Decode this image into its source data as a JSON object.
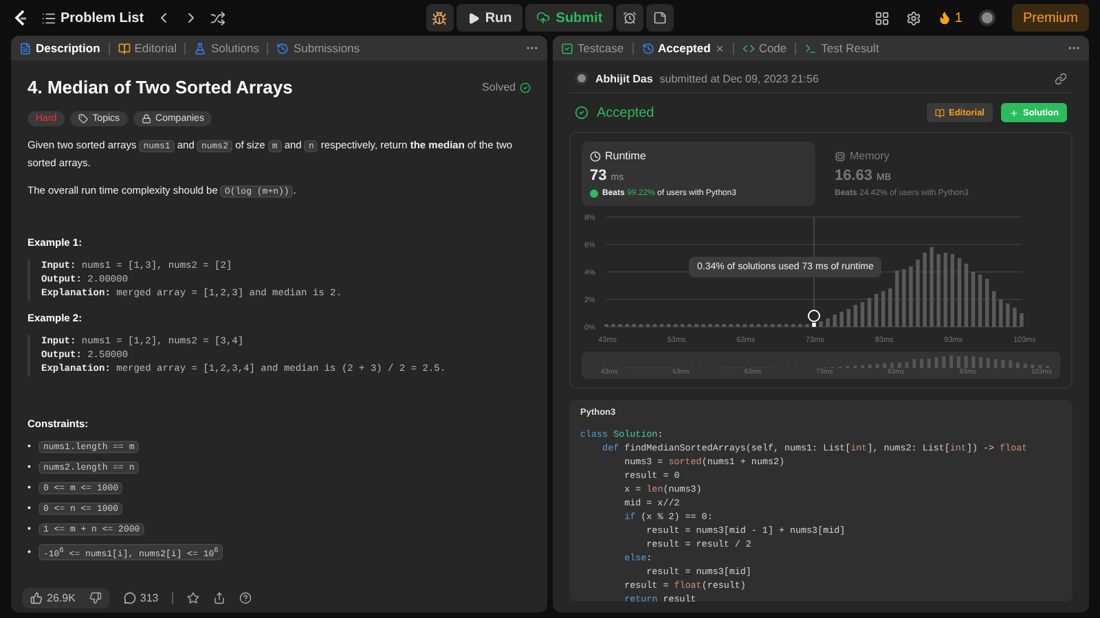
{
  "topbar": {
    "problem_list": "Problem List",
    "run": "Run",
    "submit": "Submit",
    "streak": "1",
    "premium": "Premium"
  },
  "left_panel": {
    "tabs": [
      {
        "label": "Description",
        "selected": true
      },
      {
        "label": "Editorial",
        "selected": false
      },
      {
        "label": "Solutions",
        "selected": false
      },
      {
        "label": "Submissions",
        "selected": false
      }
    ],
    "title": "4. Median of Two Sorted Arrays",
    "status": "Solved",
    "tags": [
      {
        "label": "Hard",
        "kind": "difficulty"
      },
      {
        "label": "Topics",
        "kind": "topics"
      },
      {
        "label": "Companies",
        "kind": "companies"
      }
    ],
    "paragraphs": [
      [
        {
          "text": "Given two sorted arrays ",
          "kind": "text"
        },
        {
          "text": "nums1",
          "kind": "code"
        },
        {
          "text": " and ",
          "kind": "text"
        },
        {
          "text": "nums2",
          "kind": "code"
        },
        {
          "text": " of size ",
          "kind": "text"
        },
        {
          "text": "m",
          "kind": "code"
        },
        {
          "text": " and ",
          "kind": "text"
        },
        {
          "text": "n",
          "kind": "code"
        },
        {
          "text": " respectively, return ",
          "kind": "text"
        },
        {
          "text": "the median",
          "kind": "bold"
        },
        {
          "text": " of the two sorted arrays.",
          "kind": "text"
        }
      ],
      [
        {
          "text": "The overall run time complexity should be ",
          "kind": "text"
        },
        {
          "text": "O(log (m+n))",
          "kind": "code"
        },
        {
          "text": ".",
          "kind": "text"
        }
      ]
    ],
    "examples": [
      {
        "title": "Example 1:",
        "lines": [
          {
            "label": "Input:",
            "value": "nums1 = [1,3], nums2 = [2]"
          },
          {
            "label": "Output:",
            "value": "2.00000"
          },
          {
            "label": "Explanation:",
            "value": "merged array = [1,2,3] and median is 2."
          }
        ]
      },
      {
        "title": "Example 2:",
        "lines": [
          {
            "label": "Input:",
            "value": "nums1 = [1,2], nums2 = [3,4]"
          },
          {
            "label": "Output:",
            "value": "2.50000"
          },
          {
            "label": "Explanation:",
            "value": "merged array = [1,2,3,4] and median is (2 + 3) / 2 = 2.5."
          }
        ]
      }
    ],
    "constraints_title": "Constraints:",
    "constraints": [
      {
        "marker": "•",
        "text": "nums1.length == m"
      },
      {
        "marker": "•",
        "text": "nums2.length == n"
      },
      {
        "marker": "•",
        "text": "0 <= m <= 1000"
      },
      {
        "marker": "•",
        "text": "0 <= n <= 1000"
      },
      {
        "marker": "•",
        "text": "1 <= m + n <= 2000"
      },
      {
        "marker": "•",
        "text": "-10$^{6}$ <= nums1[i], nums2[i] <= 10$^{6}$"
      }
    ],
    "footer": {
      "likes": "26.9K",
      "comments": "313"
    }
  },
  "right_panel": {
    "tabs": [
      {
        "label": "Testcase",
        "closable": false,
        "selected": false
      },
      {
        "label": "Accepted",
        "closable": true,
        "selected": true
      },
      {
        "label": "Code",
        "closable": false,
        "selected": false
      },
      {
        "label": "Test Result",
        "closable": false,
        "selected": false
      }
    ],
    "submitter": {
      "name": "Abhijit Das",
      "text": "submitted at Dec 09, 2023 21:56"
    },
    "result": "Accepted",
    "editorial_button": "Editorial",
    "solution_button": "Solution",
    "stats": [
      {
        "title": "Runtime",
        "value": "73",
        "unit": "ms",
        "beats_label": "Beats",
        "beats": "99.22%",
        "beats_text": "of users with Python3",
        "selected": true
      },
      {
        "title": "Memory",
        "value": "16.63",
        "unit": "MB",
        "beats_label": "Beats",
        "beats": "24.42%",
        "beats_text": "of users with Python3",
        "selected": false
      }
    ],
    "chart_data": {
      "type": "bar",
      "x": [
        43,
        44,
        45,
        46,
        47,
        48,
        49,
        50,
        51,
        52,
        53,
        54,
        55,
        56,
        57,
        58,
        59,
        60,
        61,
        62,
        63,
        64,
        65,
        66,
        67,
        68,
        69,
        70,
        71,
        72,
        73,
        74,
        75,
        76,
        77,
        78,
        79,
        80,
        81,
        82,
        83,
        84,
        85,
        86,
        87,
        88,
        89,
        90,
        91,
        92,
        93,
        94,
        95,
        96,
        97,
        98,
        99,
        100,
        101,
        102,
        103
      ],
      "values": [
        0.2,
        0.2,
        0.2,
        0.2,
        0.2,
        0.2,
        0.2,
        0.2,
        0.2,
        0.2,
        0.2,
        0.2,
        0.2,
        0.2,
        0.2,
        0.2,
        0.2,
        0.2,
        0.2,
        0.2,
        0.2,
        0.2,
        0.2,
        0.2,
        0.2,
        0.2,
        0.2,
        0.2,
        0.2,
        0.2,
        0.3,
        0.4,
        0.6,
        0.9,
        1.1,
        1.3,
        1.6,
        1.8,
        2.1,
        2.4,
        2.6,
        2.8,
        4.1,
        4.2,
        4.4,
        4.9,
        5.4,
        5.8,
        5.3,
        5.4,
        5.3,
        5.0,
        4.6,
        4.0,
        3.8,
        3.5,
        2.6,
        2.0,
        1.7,
        1.4,
        1.0
      ],
      "xlim": [
        43,
        103
      ],
      "grid": true,
      "ref_lines": [
        {
          "axis": "x",
          "value": 73
        }
      ],
      "ylim": [
        0,
        8
      ],
      "yticks": [
        {
          "value": 0,
          "label": "0%"
        },
        {
          "value": 2,
          "label": "2%"
        },
        {
          "value": 4,
          "label": "4%"
        },
        {
          "value": 6,
          "label": "6%"
        },
        {
          "value": 8,
          "label": "8%"
        }
      ],
      "xticks": [
        {
          "value": 43,
          "label": "43ms"
        },
        {
          "value": 53,
          "label": "53ms"
        },
        {
          "value": 63,
          "label": "63ms"
        },
        {
          "value": 73,
          "label": "73ms"
        },
        {
          "value": 83,
          "label": "83ms"
        },
        {
          "value": 93,
          "label": "93ms"
        },
        {
          "value": 103,
          "label": "103ms"
        }
      ],
      "annotations": [
        "0.34% of solutions used 73 ms of runtime"
      ]
    },
    "overview_labels": [
      "43ms",
      "53ms",
      "63ms",
      "73ms",
      "83ms",
      "93ms",
      "103ms"
    ],
    "code": {
      "language": "Python3",
      "lines": [
        [
          {
            "text": "class ",
            "kind": "keyword"
          },
          {
            "text": "Solution",
            "kind": "class"
          },
          {
            "text": ":",
            "kind": "plain"
          }
        ],
        [
          {
            "text": "    def ",
            "kind": "keyword"
          },
          {
            "text": "findMedianSortedArrays(self, nums1: List[",
            "kind": "plain"
          },
          {
            "text": "int",
            "kind": "builtin"
          },
          {
            "text": "], nums2: List[",
            "kind": "plain"
          },
          {
            "text": "int",
            "kind": "builtin"
          },
          {
            "text": "]) -> ",
            "kind": "plain"
          },
          {
            "text": "float",
            "kind": "builtin"
          }
        ],
        [
          {
            "text": "        nums3 = ",
            "kind": "plain"
          },
          {
            "text": "sorted",
            "kind": "builtin"
          },
          {
            "text": "(nums1 + nums2)",
            "kind": "plain"
          }
        ],
        [
          {
            "text": "        result = 0",
            "kind": "plain"
          }
        ],
        [
          {
            "text": "        x = ",
            "kind": "plain"
          },
          {
            "text": "len",
            "kind": "builtin"
          },
          {
            "text": "(nums3)",
            "kind": "plain"
          }
        ],
        [
          {
            "text": "        mid = x//2",
            "kind": "plain"
          }
        ],
        [
          {
            "text": "        if ",
            "kind": "keyword"
          },
          {
            "text": "(x % 2) == 0:",
            "kind": "plain"
          }
        ],
        [
          {
            "text": "            result = nums3[mid - 1] + nums3[mid]",
            "kind": "plain"
          }
        ],
        [
          {
            "text": "            result = result / 2",
            "kind": "plain"
          }
        ],
        [
          {
            "text": "        else",
            "kind": "keyword"
          },
          {
            "text": ":",
            "kind": "plain"
          }
        ],
        [
          {
            "text": "            result = nums3[mid]",
            "kind": "plain"
          }
        ],
        [
          {
            "text": "        result = ",
            "kind": "plain"
          },
          {
            "text": "float",
            "kind": "builtin"
          },
          {
            "text": "(result)",
            "kind": "plain"
          }
        ],
        [
          {
            "text": "        return ",
            "kind": "keyword"
          },
          {
            "text": "result",
            "kind": "plain"
          }
        ]
      ]
    }
  }
}
